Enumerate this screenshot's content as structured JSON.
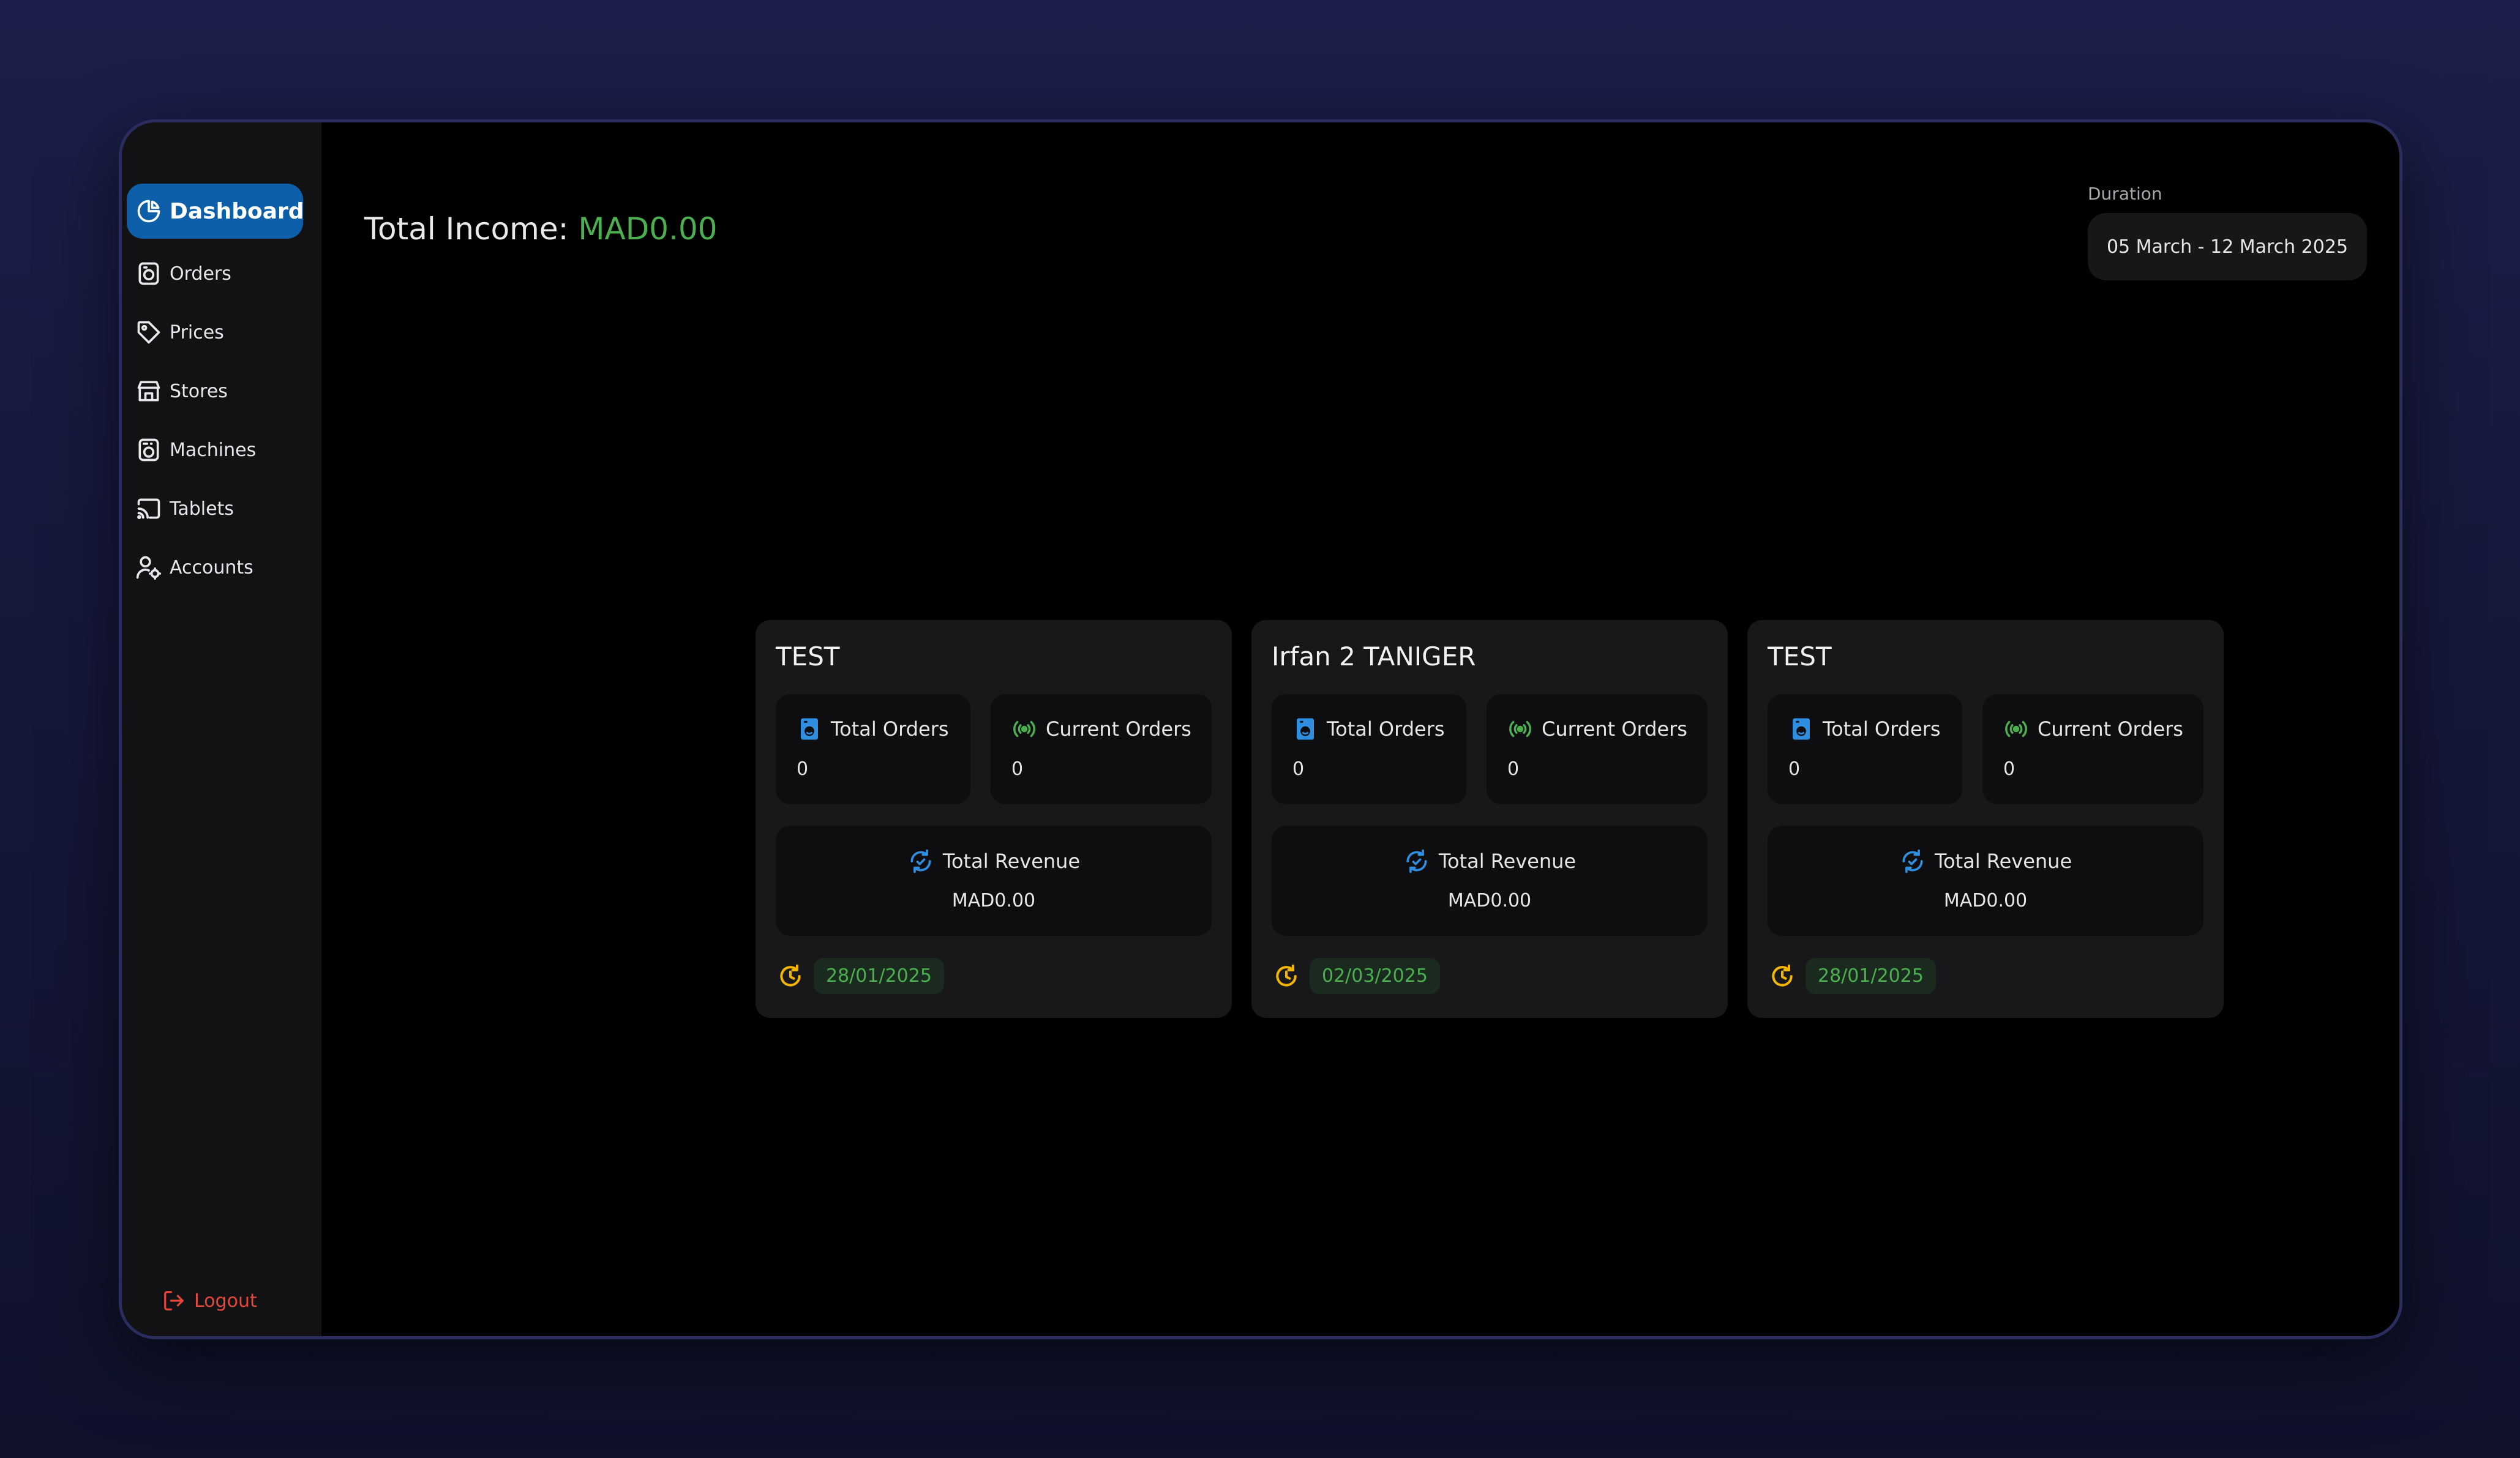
{
  "sidebar": {
    "items": [
      {
        "label": "Dashboard",
        "icon": "dashboard-pie-icon"
      },
      {
        "label": "Orders",
        "icon": "orders-icon"
      },
      {
        "label": "Prices",
        "icon": "price-tag-icon"
      },
      {
        "label": "Stores",
        "icon": "store-icon"
      },
      {
        "label": "Machines",
        "icon": "washing-machine-icon"
      },
      {
        "label": "Tablets",
        "icon": "cast-icon"
      },
      {
        "label": "Accounts",
        "icon": "user-settings-icon"
      }
    ],
    "logout_label": "Logout"
  },
  "header": {
    "income_label": "Total Income:",
    "income_value": "MAD0.00",
    "duration_label": "Duration",
    "duration_value": "05 March - 12 March 2025"
  },
  "stores": [
    {
      "name": "TEST",
      "total_orders_label": "Total Orders",
      "total_orders": "0",
      "current_orders_label": "Current Orders",
      "current_orders": "0",
      "revenue_label": "Total Revenue",
      "revenue": "MAD0.00",
      "date": "28/01/2025"
    },
    {
      "name": "Irfan 2 TANIGER",
      "total_orders_label": "Total Orders",
      "total_orders": "0",
      "current_orders_label": "Current Orders",
      "current_orders": "0",
      "revenue_label": "Total Revenue",
      "revenue": "MAD0.00",
      "date": "02/03/2025"
    },
    {
      "name": "TEST",
      "total_orders_label": "Total Orders",
      "total_orders": "0",
      "current_orders_label": "Current Orders",
      "current_orders": "0",
      "revenue_label": "Total Revenue",
      "revenue": "MAD0.00",
      "date": "28/01/2025"
    }
  ],
  "colors": {
    "accent": "#0c5fa8",
    "income_green": "#4caf50",
    "logout_red": "#e5483a",
    "clock_yellow": "#f2b600",
    "icon_blue": "#2f8ee0"
  }
}
